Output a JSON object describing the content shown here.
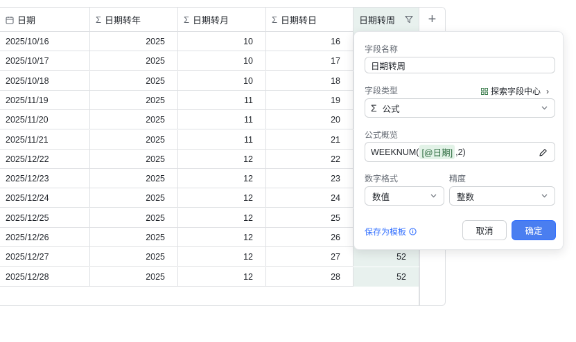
{
  "table": {
    "columns": [
      {
        "icon": "calendar-icon",
        "label": "日期"
      },
      {
        "icon": "sigma-icon",
        "label": "日期转年"
      },
      {
        "icon": "sigma-icon",
        "label": "日期转月"
      },
      {
        "icon": "sigma-icon",
        "label": "日期转日"
      },
      {
        "icon": "",
        "label": "日期转周"
      }
    ],
    "add_column": "+",
    "rows": [
      {
        "date": "2025/10/16",
        "year": "2025",
        "month": "10",
        "day": "16",
        "week": ""
      },
      {
        "date": "2025/10/17",
        "year": "2025",
        "month": "10",
        "day": "17",
        "week": ""
      },
      {
        "date": "2025/10/18",
        "year": "2025",
        "month": "10",
        "day": "18",
        "week": ""
      },
      {
        "date": "2025/11/19",
        "year": "2025",
        "month": "11",
        "day": "19",
        "week": ""
      },
      {
        "date": "2025/11/20",
        "year": "2025",
        "month": "11",
        "day": "20",
        "week": ""
      },
      {
        "date": "2025/11/21",
        "year": "2025",
        "month": "11",
        "day": "21",
        "week": ""
      },
      {
        "date": "2025/12/22",
        "year": "2025",
        "month": "12",
        "day": "22",
        "week": ""
      },
      {
        "date": "2025/12/23",
        "year": "2025",
        "month": "12",
        "day": "23",
        "week": ""
      },
      {
        "date": "2025/12/24",
        "year": "2025",
        "month": "12",
        "day": "24",
        "week": ""
      },
      {
        "date": "2025/12/25",
        "year": "2025",
        "month": "12",
        "day": "25",
        "week": ""
      },
      {
        "date": "2025/12/26",
        "year": "2025",
        "month": "12",
        "day": "26",
        "week": ""
      },
      {
        "date": "2025/12/27",
        "year": "2025",
        "month": "12",
        "day": "27",
        "week": "52"
      },
      {
        "date": "2025/12/28",
        "year": "2025",
        "month": "12",
        "day": "28",
        "week": "52"
      }
    ]
  },
  "panel": {
    "field_name_label": "字段名称",
    "field_name_value": "日期转周",
    "field_type_label": "字段类型",
    "explore_link": "探索字段中心",
    "field_type_value": "公式",
    "formula_label": "公式概览",
    "formula_prefix": "WEEKNUM(",
    "formula_tag": "[@日期]",
    "formula_suffix": ",2)",
    "number_format_label": "数字格式",
    "number_format_value": "数值",
    "precision_label": "精度",
    "precision_value": "整数",
    "save_template": "保存为模板",
    "cancel": "取消",
    "confirm": "确定"
  },
  "colors": {
    "accent": "#3370ff",
    "active_column": "#e8f1ee",
    "formula_tag": "#e2f2e7"
  }
}
